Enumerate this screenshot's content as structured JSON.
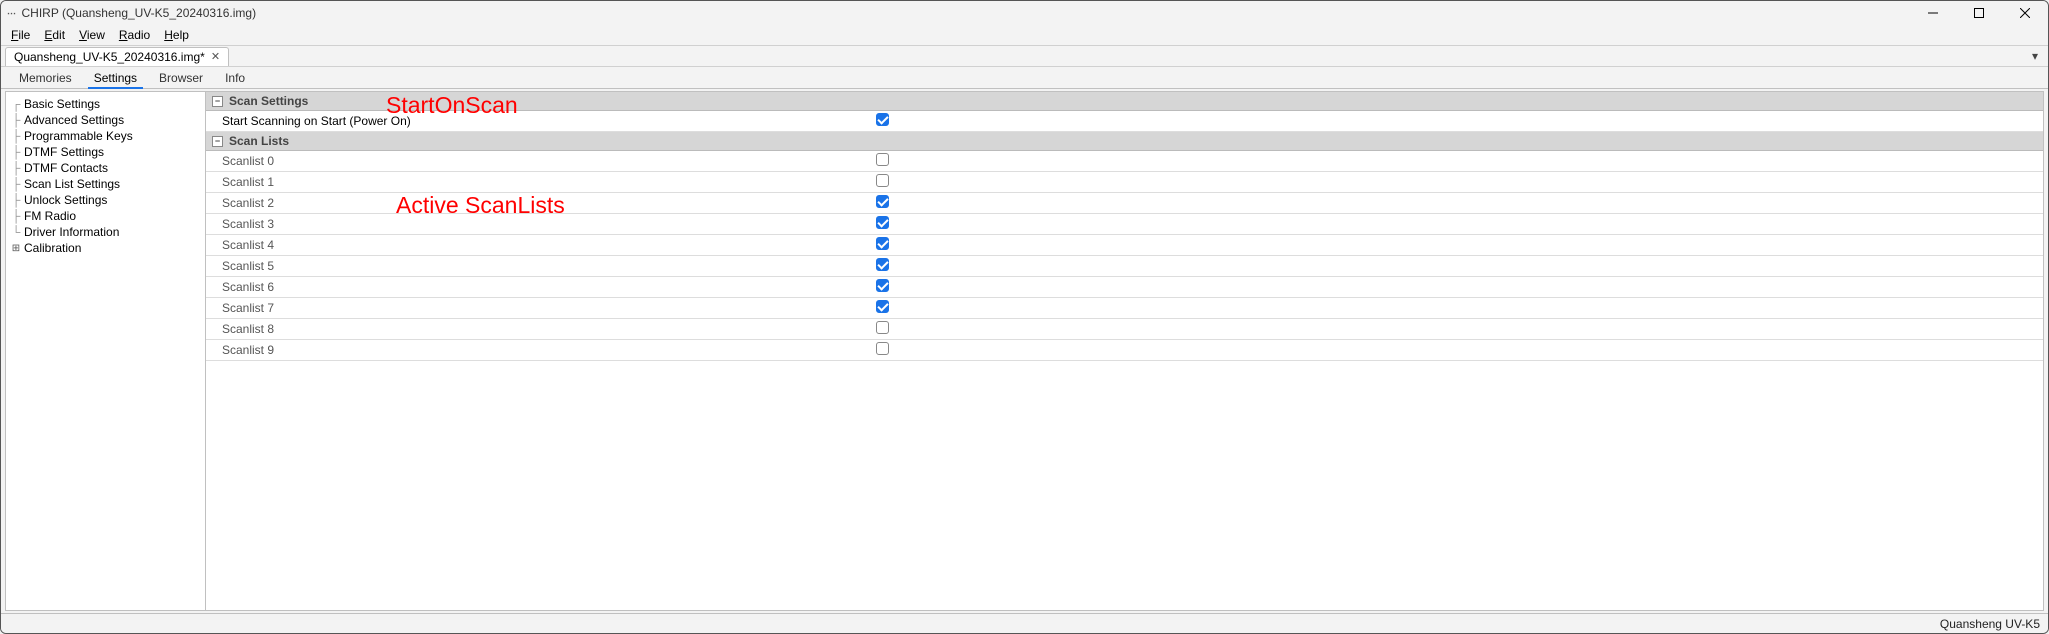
{
  "window": {
    "title": "CHIRP (Quansheng_UV-K5_20240316.img)"
  },
  "menubar": {
    "file": "File",
    "edit": "Edit",
    "view": "View",
    "radio": "Radio",
    "help": "Help"
  },
  "file_tab": {
    "label": "Quansheng_UV-K5_20240316.img*"
  },
  "view_tabs": {
    "memories": "Memories",
    "settings": "Settings",
    "browser": "Browser",
    "info": "Info"
  },
  "sidebar": {
    "items": [
      "Basic Settings",
      "Advanced Settings",
      "Programmable Keys",
      "DTMF Settings",
      "DTMF Contacts",
      "Scan List Settings",
      "Unlock Settings",
      "FM Radio",
      "Driver Information"
    ],
    "calibration": "Calibration"
  },
  "sections": {
    "scan_settings": {
      "title": "Scan Settings",
      "start_on_scan": "Start Scanning on Start (Power On)"
    },
    "scan_lists": {
      "title": "Scan Lists",
      "items": [
        {
          "label": "Scanlist 0",
          "checked": false
        },
        {
          "label": "Scanlist 1",
          "checked": false
        },
        {
          "label": "Scanlist 2",
          "checked": true
        },
        {
          "label": "Scanlist 3",
          "checked": true
        },
        {
          "label": "Scanlist 4",
          "checked": true
        },
        {
          "label": "Scanlist 5",
          "checked": true
        },
        {
          "label": "Scanlist 6",
          "checked": true
        },
        {
          "label": "Scanlist 7",
          "checked": true
        },
        {
          "label": "Scanlist 8",
          "checked": false
        },
        {
          "label": "Scanlist 9",
          "checked": false
        }
      ]
    }
  },
  "annotations": {
    "start_on_scan": "StartOnScan",
    "active_scanlists": "Active ScanLists"
  },
  "statusbar": {
    "device": "Quansheng UV-K5"
  }
}
